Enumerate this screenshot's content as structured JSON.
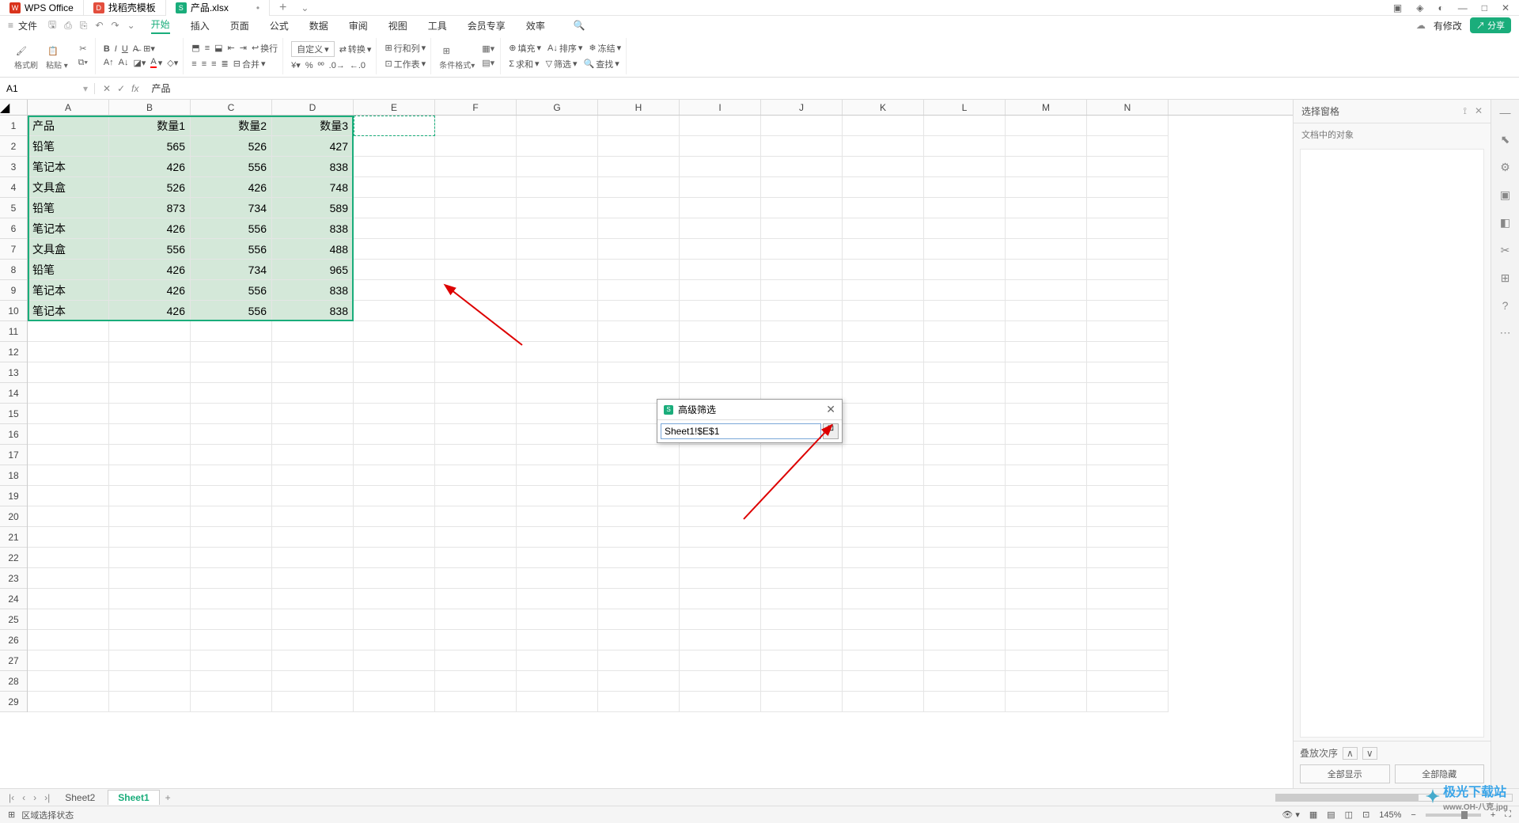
{
  "tabs": {
    "t0": "WPS Office",
    "t1": "找稻壳模板",
    "t2": "产品.xlsx"
  },
  "menu": {
    "file": "文件",
    "m0": "开始",
    "m1": "插入",
    "m2": "页面",
    "m3": "公式",
    "m4": "数据",
    "m5": "审阅",
    "m6": "视图",
    "m7": "工具",
    "m8": "会员专享",
    "m9": "效率"
  },
  "topright": {
    "modify": "有修改",
    "share": "分享"
  },
  "ribbon": {
    "brush": "格式刷",
    "paste": "粘贴",
    "custom": "自定义",
    "convert": "转换",
    "rowcol": "行和列",
    "worksheet": "工作表",
    "condfmt": "条件格式",
    "fill": "填充",
    "sort": "排序",
    "freeze": "冻结",
    "sum": "求和",
    "filter": "筛选",
    "find": "查找",
    "wrap": "换行",
    "merge": "合并"
  },
  "cellref": "A1",
  "fxvalue": "产品",
  "cols": [
    "A",
    "B",
    "C",
    "D",
    "E",
    "F",
    "G",
    "H",
    "I",
    "J",
    "K",
    "L",
    "M",
    "N"
  ],
  "table": {
    "headers": [
      "产品",
      "数量1",
      "数量2",
      "数量3"
    ],
    "rows": [
      [
        "铅笔",
        565,
        526,
        427
      ],
      [
        "笔记本",
        426,
        556,
        838
      ],
      [
        "文具盒",
        526,
        426,
        748
      ],
      [
        "铅笔",
        873,
        734,
        589
      ],
      [
        "笔记本",
        426,
        556,
        838
      ],
      [
        "文具盒",
        556,
        556,
        488
      ],
      [
        "铅笔",
        426,
        734,
        965
      ],
      [
        "笔记本",
        426,
        556,
        838
      ],
      [
        "笔记本",
        426,
        556,
        838
      ]
    ]
  },
  "dialog": {
    "title": "高级筛选",
    "value": "Sheet1!$E$1"
  },
  "rpanel": {
    "title": "选择窗格",
    "sub": "文档中的对象",
    "order": "叠放次序",
    "showall": "全部显示",
    "hideall": "全部隐藏"
  },
  "sheets": {
    "s1": "Sheet2",
    "s2": "Sheet1"
  },
  "status": {
    "mode": "区域选择状态",
    "zoom": "145%"
  },
  "watermark": {
    "main": "极光下载站",
    "sub": "www.OH-八克.jpg"
  }
}
